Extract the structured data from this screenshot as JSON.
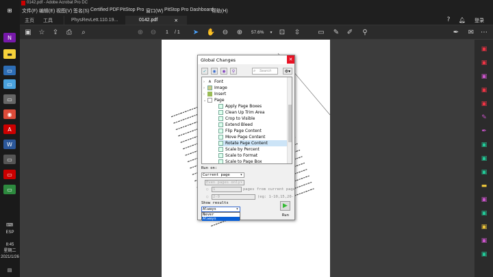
{
  "taskbar": {
    "lang": "ESP",
    "time": "8:45",
    "weekday": "星期二",
    "date": "2021/1/26"
  },
  "window": {
    "title": "0142.pdf - Adobe Acrobat Pro DC"
  },
  "menu": [
    "文件(F)",
    "编辑(E)",
    "视图(V)",
    "签名(S)",
    "Certified PDF",
    "PitStop Pro",
    "窗口(W)",
    "PitStop Pro Dashboard",
    "帮助(H)"
  ],
  "tabs": {
    "home": "主页",
    "tools": "工具",
    "doc1": "PhysRevLett.110.19...",
    "doc2": "0142.pdf",
    "login": "登录"
  },
  "toolbar": {
    "page_current": "1",
    "page_total": "/ 1",
    "zoom": "57.6%"
  },
  "dialog": {
    "title": "Global Changes",
    "search_placeholder": "Search",
    "tree": [
      {
        "label": "Font",
        "level": 1
      },
      {
        "label": "Image",
        "level": 1
      },
      {
        "label": "Insert",
        "level": 1
      },
      {
        "label": "Page",
        "level": 1
      },
      {
        "label": "Apply Page Boxes",
        "level": 2
      },
      {
        "label": "Clean Up Trim Area",
        "level": 2
      },
      {
        "label": "Crop to Visible",
        "level": 2
      },
      {
        "label": "Extend Bleed",
        "level": 2
      },
      {
        "label": "Flip Page Content",
        "level": 2
      },
      {
        "label": "Move Page Content",
        "level": 2
      },
      {
        "label": "Rotate Page Content",
        "level": 2
      },
      {
        "label": "Scale by Percent",
        "level": 2
      },
      {
        "label": "Scale to Format",
        "level": 2
      },
      {
        "label": "Scale to Page Box",
        "level": 2
      }
    ],
    "run_on_label": "Run on:",
    "run_on_value": "Current page",
    "even_pages": "Even pages only",
    "pages_count": "1",
    "pages_from_current": "pages from current page",
    "range_value": "2-9",
    "range_hint": "(eg: 1-10,15,20-)",
    "show_results_label": "Show results",
    "show_results_value": "Always",
    "options": [
      "Never",
      "Always"
    ],
    "run_label": "Run"
  }
}
